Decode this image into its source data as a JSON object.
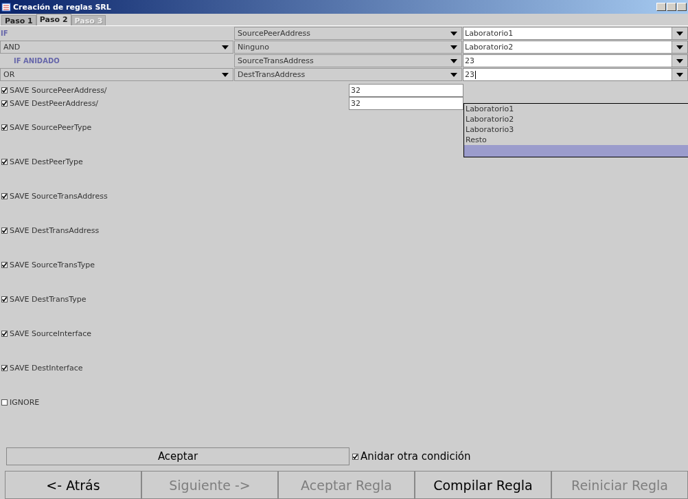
{
  "window": {
    "title": "Creación de reglas SRL"
  },
  "tabs": [
    {
      "label": "Paso 1",
      "selected": false,
      "disabled": false
    },
    {
      "label": "Paso 2",
      "selected": true,
      "disabled": false
    },
    {
      "label": "Paso 3",
      "selected": false,
      "disabled": true
    }
  ],
  "conditions": [
    {
      "kind": "label",
      "operator": "IF",
      "field": "SourcePeerAddress",
      "value": "Laboratorio1"
    },
    {
      "kind": "combo",
      "operator": "AND",
      "field": "Ninguno",
      "value": "Laboratorio2"
    },
    {
      "kind": "nested_label",
      "operator": "IF ANIDADO",
      "field": "SourceTransAddress",
      "value": "23"
    },
    {
      "kind": "combo",
      "operator": "OR",
      "field": "DestTransAddress",
      "value": "23"
    }
  ],
  "saves": [
    {
      "label": "SAVE SourcePeerAddress/",
      "checked": true,
      "mask": "32"
    },
    {
      "label": "SAVE DestPeerAddress/",
      "checked": true,
      "mask": "32"
    },
    {
      "label": "SAVE SourcePeerType",
      "checked": true
    },
    {
      "label": "SAVE DestPeerType",
      "checked": true
    },
    {
      "label": "SAVE SourceTransAddress",
      "checked": true
    },
    {
      "label": "SAVE DestTransAddress",
      "checked": true
    },
    {
      "label": "SAVE SourceTransType",
      "checked": true
    },
    {
      "label": "SAVE DestTransType",
      "checked": true
    },
    {
      "label": "SAVE SourceInterface",
      "checked": true
    },
    {
      "label": "SAVE DestInterface",
      "checked": true
    },
    {
      "label": "IGNORE",
      "checked": false
    }
  ],
  "dropdown": {
    "options": [
      "Laboratorio1",
      "Laboratorio2",
      "Laboratorio3",
      "Resto"
    ],
    "blank_row_highlighted": true
  },
  "accept_button": "Aceptar",
  "nest_checkbox": {
    "label": "Anidar otra condición",
    "checked": true
  },
  "buttons": [
    {
      "label": "<- Atrás",
      "disabled": false
    },
    {
      "label": "Siguiente ->",
      "disabled": true
    },
    {
      "label": "Aceptar Regla",
      "disabled": true
    },
    {
      "label": "Compilar Regla",
      "disabled": false
    },
    {
      "label": "Reiniciar Regla",
      "disabled": true
    }
  ]
}
